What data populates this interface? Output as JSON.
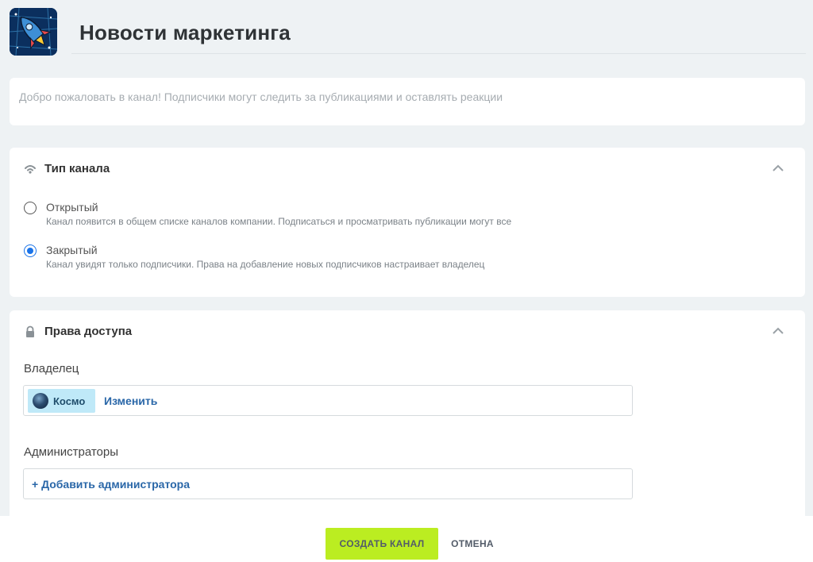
{
  "header": {
    "title": "Новости маркетинга",
    "avatar_icon": "rocket-icon"
  },
  "description": {
    "value": "",
    "placeholder": "Добро пожаловать в канал! Подписчики могут следить за публикациями и оставлять реакции"
  },
  "channel_type": {
    "title": "Тип канала",
    "icon": "signal-icon",
    "options": [
      {
        "label": "Открытый",
        "desc": "Канал появится в общем списке каналов компании. Подписаться и просматривать публикации могут все",
        "checked": false
      },
      {
        "label": "Закрытый",
        "desc": "Канал увидят только подписчики. Права на добавление новых подписчиков настраивает владелец",
        "checked": true
      }
    ]
  },
  "access": {
    "title": "Права доступа",
    "icon": "lock-icon",
    "owner_label": "Владелец",
    "owner_name": "Космо",
    "change_label": "Изменить",
    "admins_label": "Администраторы",
    "add_admin_label": "+ Добавить администратора"
  },
  "footer": {
    "create_label": "СОЗДАТЬ КАНАЛ",
    "cancel_label": "ОТМЕНА"
  },
  "colors": {
    "accent": "#bbed21",
    "link": "#2a67a8",
    "radio": "#1a73e8"
  }
}
